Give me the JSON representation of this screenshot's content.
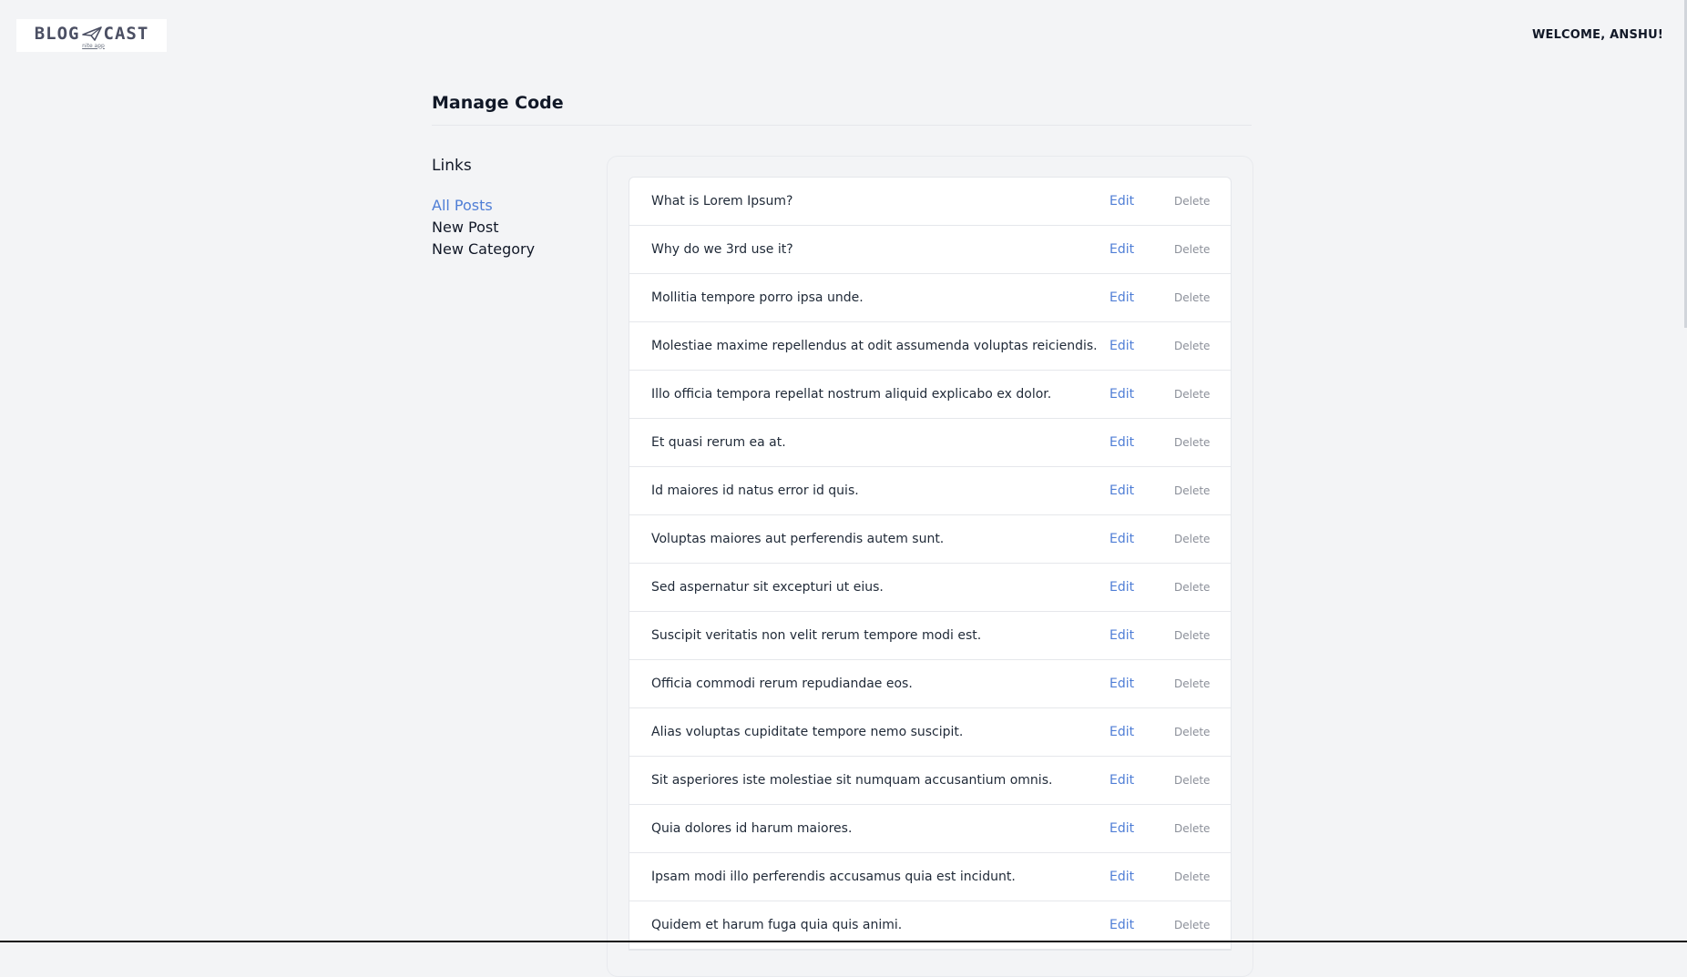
{
  "header": {
    "logo_text_left": "BLOG",
    "logo_text_right": "CAST",
    "logo_sub": "nite app",
    "welcome": "WELCOME, ANSHU!"
  },
  "page": {
    "title": "Manage Code"
  },
  "sidebar": {
    "heading": "Links",
    "items": [
      {
        "label": "All Posts",
        "active": true
      },
      {
        "label": "New Post",
        "active": false
      },
      {
        "label": "New Category",
        "active": false
      }
    ]
  },
  "posts": {
    "edit_label": "Edit",
    "delete_label": "Delete",
    "rows": [
      "What is Lorem Ipsum?",
      "Why do we 3rd use it?",
      "Mollitia tempore porro ipsa unde.",
      "Molestiae maxime repellendus at odit assumenda voluptas reiciendis.",
      "Illo officia tempora repellat nostrum aliquid explicabo ex dolor.",
      "Et quasi rerum ea at.",
      "Id maiores id natus error id quis.",
      "Voluptas maiores aut perferendis autem sunt.",
      "Sed aspernatur sit excepturi ut eius.",
      "Suscipit veritatis non velit rerum tempore modi est.",
      "Officia commodi rerum repudiandae eos.",
      "Alias voluptas cupiditate tempore nemo suscipit.",
      "Sit asperiores iste molestiae sit numquam accusantium omnis.",
      "Quia dolores id harum maiores.",
      "Ipsam modi illo perferendis accusamus quia est incidunt.",
      "Quidem et harum fuga quia quis animi."
    ]
  },
  "colors": {
    "background": "#f3f4f6",
    "accent": "#4f7ed6",
    "muted": "#8b8f99"
  },
  "icons": {
    "logo": "paper-plane-icon"
  }
}
